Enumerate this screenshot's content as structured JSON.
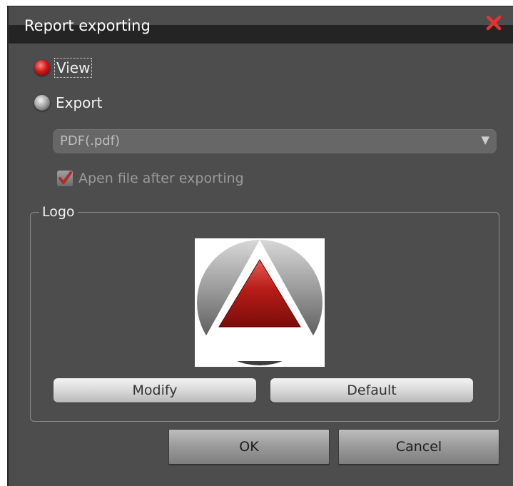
{
  "dialog": {
    "title": "Report exporting",
    "close_icon": "close-x-icon"
  },
  "options": {
    "view_label": "View",
    "export_label": "Export",
    "selected": "View"
  },
  "format_select": {
    "value": "PDF(.pdf)",
    "enabled": false
  },
  "open_after_export": {
    "label": "Apen file after exporting",
    "checked": true,
    "enabled": false
  },
  "logo_group": {
    "label": "Logo",
    "image": "logo-triangle-icon",
    "modify_label": "Modify",
    "default_label": "Default"
  },
  "footer": {
    "ok_label": "OK",
    "cancel_label": "Cancel"
  },
  "colors": {
    "background": "#4d4d4d",
    "title_bar": "#242424",
    "accent_red": "#c8201e"
  }
}
